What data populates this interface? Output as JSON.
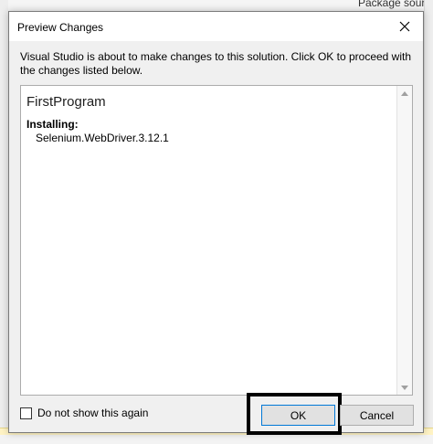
{
  "background": {
    "top_right_text": "Package source"
  },
  "dialog": {
    "title": "Preview Changes",
    "description": "Visual Studio is about to make changes to this solution. Click OK to proceed with the changes listed below.",
    "changes": {
      "project": "FirstProgram",
      "action_label": "Installing:",
      "package": "Selenium.WebDriver.3.12.1"
    },
    "checkbox_label": "Do not show this again",
    "ok_label": "OK",
    "cancel_label": "Cancel"
  },
  "icons": {
    "close": "close-icon",
    "scroll_up": "chevron-up-icon",
    "scroll_down": "chevron-down-icon"
  },
  "colors": {
    "focus_border": "#0078d7",
    "highlight_border": "#000000"
  }
}
